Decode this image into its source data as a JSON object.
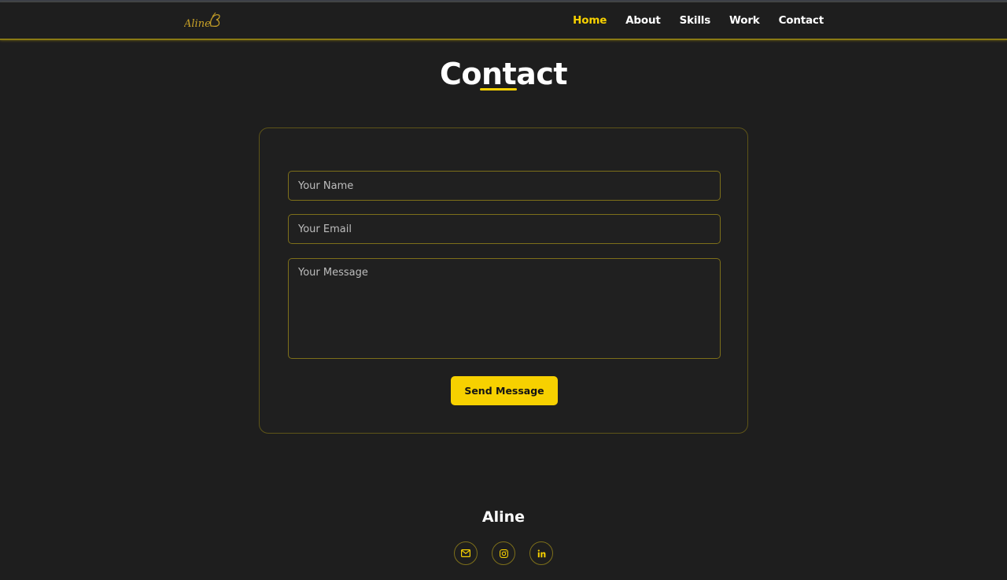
{
  "brand": {
    "logo_text": "Aline"
  },
  "nav": {
    "items": [
      {
        "label": "Home",
        "active": true
      },
      {
        "label": "About",
        "active": false
      },
      {
        "label": "Skills",
        "active": false
      },
      {
        "label": "Work",
        "active": false
      },
      {
        "label": "Contact",
        "active": false
      }
    ]
  },
  "page": {
    "title": "Contact"
  },
  "form": {
    "name_placeholder": "Your Name",
    "email_placeholder": "Your Email",
    "message_placeholder": "Your Message",
    "send_label": "Send Message"
  },
  "footer": {
    "name": "Aline",
    "socials": [
      {
        "icon": "mail-icon"
      },
      {
        "icon": "instagram-icon"
      },
      {
        "icon": "linkedin-icon"
      }
    ]
  },
  "colors": {
    "accent": "#f7d100",
    "background": "#1e1e1e",
    "border": "#7d6f1a"
  }
}
